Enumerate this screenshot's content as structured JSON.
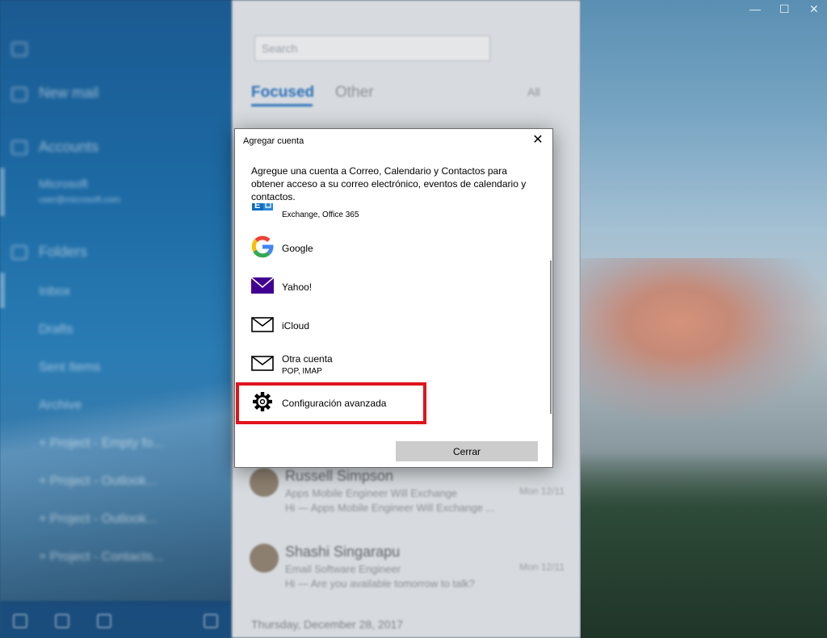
{
  "background_app": {
    "sidebar": {
      "new_mail": "New mail",
      "accounts": "Accounts",
      "account_name": "Microsoft",
      "account_email": "user@microsoft.com",
      "folders": "Folders",
      "folder_items": [
        "Inbox",
        "Drafts",
        "Sent Items",
        "Archive",
        "+ Project - Empty fo...",
        "+ Project - Outlook...",
        "+ Project - Outlook...",
        "+ Project - Contacts..."
      ]
    },
    "list": {
      "search_placeholder": "Search",
      "tab_focused": "Focused",
      "tab_other": "Other",
      "filter": "All",
      "messages": [
        {
          "sender": "Russell Simpson",
          "subject": "Apps Mobile Engineer Will Exchange",
          "preview": "Hi — Apps Mobile Engineer Will Exchange ...",
          "date": "Mon 12/11"
        },
        {
          "sender": "Shashi Singarapu",
          "subject": "Email Software Engineer",
          "preview": "Hi — Are you available tomorrow to talk?",
          "date": "Mon 12/11"
        }
      ],
      "date_header": "Thursday, December 28, 2017"
    },
    "window_controls": {
      "minimize": "—",
      "maximize": "☐",
      "close": "✕"
    }
  },
  "dialog": {
    "title": "Agregar cuenta",
    "close_glyph": "✕",
    "description": "Agregue una cuenta a Correo, Calendario y Contactos para obtener acceso a su correo electrónico, eventos de calendario y contactos.",
    "options": [
      {
        "icon": "exchange-icon",
        "label": "",
        "sublabel": "Exchange, Office 365"
      },
      {
        "icon": "google-icon",
        "label": "Google",
        "sublabel": ""
      },
      {
        "icon": "yahoo-mail-icon",
        "label": "Yahoo!",
        "sublabel": ""
      },
      {
        "icon": "envelope-icon",
        "label": "iCloud",
        "sublabel": ""
      },
      {
        "icon": "envelope-icon",
        "label": "Otra cuenta",
        "sublabel": "POP, IMAP"
      },
      {
        "icon": "gear-icon",
        "label": "Configuración avanzada",
        "sublabel": ""
      }
    ],
    "close_button": "Cerrar",
    "highlight_color": "#e0141c"
  }
}
